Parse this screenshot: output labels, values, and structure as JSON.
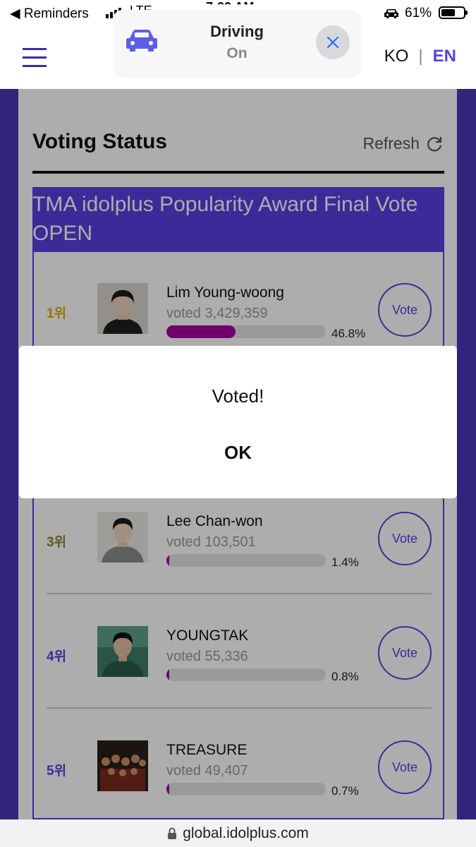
{
  "status_bar": {
    "back_app": "Reminders",
    "carrier": "LTE",
    "time": "7:22 AM",
    "battery": "61%",
    "battery_level": 0.61
  },
  "driving_banner": {
    "title": "Driving",
    "state": "On",
    "icons": {
      "car": "car-icon",
      "close": "close-icon"
    }
  },
  "header": {
    "menu_icon": "hamburger-menu-icon",
    "lang_ko": "KO",
    "lang_sep": "|",
    "lang_en": "EN"
  },
  "voting": {
    "title": "Voting Status",
    "refresh_label": "Refresh",
    "award_title": "TMA idolplus Popularity Award Final Vote OPEN",
    "vote_label": "Vote",
    "candidates": [
      {
        "rank": "1위",
        "name": "Lim Young-woong",
        "votes": "voted 3,429,359",
        "percent": "46.8%",
        "fill": 0.468
      },
      {
        "rank": "3위",
        "name": "Lee Chan-won",
        "votes": "voted 103,501",
        "percent": "1.4%",
        "fill": 0.014
      },
      {
        "rank": "4위",
        "name": "YOUNGTAK",
        "votes": "voted 55,336",
        "percent": "0.8%",
        "fill": 0.008
      },
      {
        "rank": "5위",
        "name": "TREASURE",
        "votes": "voted 49,407",
        "percent": "0.7%",
        "fill": 0.007
      }
    ]
  },
  "dialog": {
    "message": "Voted!",
    "ok_label": "OK"
  },
  "url_bar": {
    "url": "global.idolplus.com"
  },
  "colors": {
    "accent": "#5b3fe0",
    "frame": "#4a34b6",
    "bar_fill": "#a5009e",
    "rank_gold": "#e6a800",
    "rank_olive": "#8a8a2a"
  }
}
